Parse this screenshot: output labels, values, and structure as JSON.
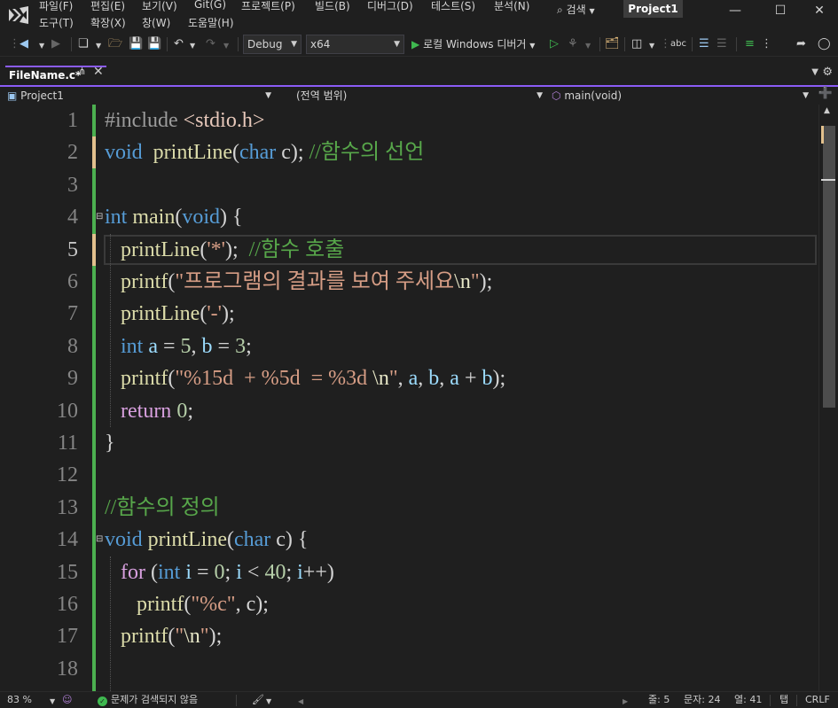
{
  "menu": {
    "row1": [
      "파일(F)",
      "편집(E)",
      "보기(V)",
      "Git(G)",
      "프로젝트(P)",
      "빌드(B)",
      "디버그(D)",
      "테스트(S)",
      "분석(N)"
    ],
    "row2": [
      "도구(T)",
      "확장(X)",
      "창(W)",
      "도움말(H)"
    ],
    "search_label": "검색",
    "project_name": "Project1"
  },
  "toolbar": {
    "config": "Debug",
    "platform": "x64",
    "run_label": "로컬 Windows 디버거"
  },
  "tab": {
    "file_name": "FileName.c*"
  },
  "navbar": {
    "project": "Project1",
    "scope": "(전역 범위)",
    "member": "main(void)"
  },
  "editor": {
    "line_numbers": [
      "1",
      "2",
      "3",
      "4",
      "5",
      "6",
      "7",
      "8",
      "9",
      "10",
      "11",
      "12",
      "13",
      "14",
      "15",
      "16",
      "17",
      "18"
    ],
    "current_line": 5
  },
  "statusbar": {
    "zoom": "83 %",
    "issues": "문제가 검색되지 않음",
    "line": "줄: 5",
    "char": "문자: 24",
    "col": "열: 41",
    "tab_mode": "탭",
    "eol": "CRLF"
  },
  "colors": {
    "accent": "#8b5cf6",
    "change_saved": "#4caf50",
    "change_unsaved": "#e2c08d"
  }
}
